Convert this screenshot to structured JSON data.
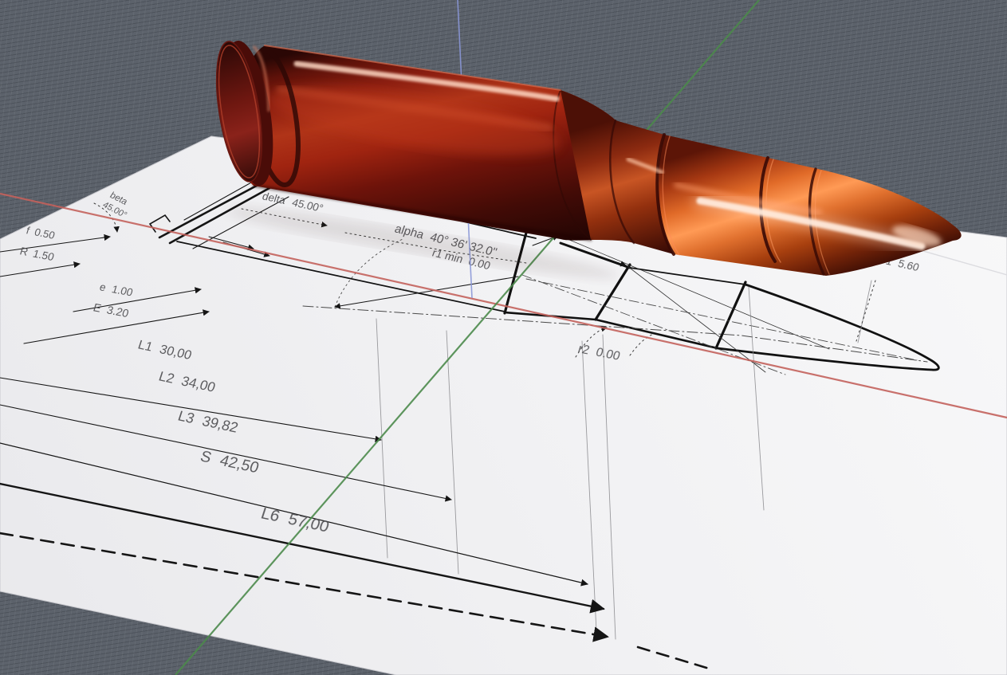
{
  "scene": {
    "model_name": "rifle-cartridge-3d-model",
    "surface_name": "technical-drawing-sheet"
  },
  "colors": {
    "viewport_background": "#5c626b",
    "sheet": "#f2f2f4",
    "axis_x_red": "#c4625c",
    "axis_y_green": "#4c8a4c",
    "axis_z_blue": "#8a97d8",
    "drawing_line": "#1a1a1a",
    "dimension_text": "#4f4f52",
    "model_body": "#8c1a10",
    "model_bullet": "#e06a28",
    "model_highlight": "#fff2e8"
  },
  "dims": {
    "beta": {
      "name": "beta",
      "value": "45.00°"
    },
    "delta": {
      "name": "delta",
      "value": "45.00°"
    },
    "alpha": {
      "name": "alpha",
      "value": "40° 36' 32.0\""
    },
    "r1_min": {
      "name": "r1 min",
      "value": "0.00"
    },
    "f": {
      "name": "f",
      "value": "0.50"
    },
    "R": {
      "name": "R",
      "value": "1.50"
    },
    "e": {
      "name": "e",
      "value": "1.00"
    },
    "E": {
      "name": "E",
      "value": "3.20"
    },
    "L1": {
      "name": "L1",
      "value": "30,00"
    },
    "L2": {
      "name": "L2",
      "value": "34,00"
    },
    "L3": {
      "name": "L3",
      "value": "39,82"
    },
    "S": {
      "name": "S",
      "value": "42,50"
    },
    "L6": {
      "name": "L6",
      "value": "57,00"
    },
    "r2": {
      "name": "r2",
      "value": "0.00"
    },
    "G1": {
      "name": "Ø G1",
      "value": "5.60"
    }
  }
}
